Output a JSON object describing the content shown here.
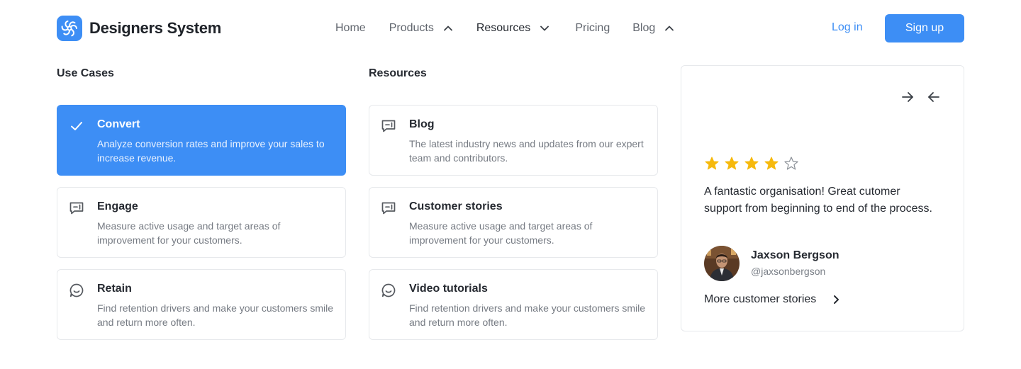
{
  "brand": {
    "name": "Designers System",
    "icon": "brand-swirl-icon",
    "accent": "#3d8ef5"
  },
  "nav": {
    "home": "Home",
    "products": "Products",
    "resources": "Resources",
    "pricing": "Pricing",
    "blog": "Blog"
  },
  "auth": {
    "login": "Log in",
    "signup": "Sign up"
  },
  "use_cases": {
    "heading": "Use Cases",
    "items": [
      {
        "title": "Convert",
        "desc": "Analyze conversion rates and improve your sales to increase revenue.",
        "icon": "check-icon",
        "selected": true
      },
      {
        "title": "Engage",
        "desc": "Measure active usage and target areas of improvement for your customers.",
        "icon": "message-plus-icon"
      },
      {
        "title": "Retain",
        "desc": "Find retention drivers and make your customers smile and return more often.",
        "icon": "smile-chat-icon"
      }
    ]
  },
  "resources": {
    "heading": "Resources",
    "items": [
      {
        "title": "Blog",
        "desc": "The latest industry news and updates from our expert team and contributors.",
        "icon": "message-plus-icon"
      },
      {
        "title": "Customer stories",
        "desc": "Measure active usage and target areas of improvement for your customers.",
        "icon": "message-plus-icon"
      },
      {
        "title": "Video tutorials",
        "desc": "Find retention drivers and make your customers smile and return more often.",
        "icon": "smile-chat-icon"
      }
    ]
  },
  "testimonial": {
    "rating": 4,
    "rating_max": 5,
    "quote": "A fantastic organisation! Great cutomer support from beginning to end of the process.",
    "author_name": "Jaxson Bergson",
    "author_handle": "@jaxsonbergson",
    "more_link": "More customer stories",
    "star_color": "#f6b90c"
  }
}
